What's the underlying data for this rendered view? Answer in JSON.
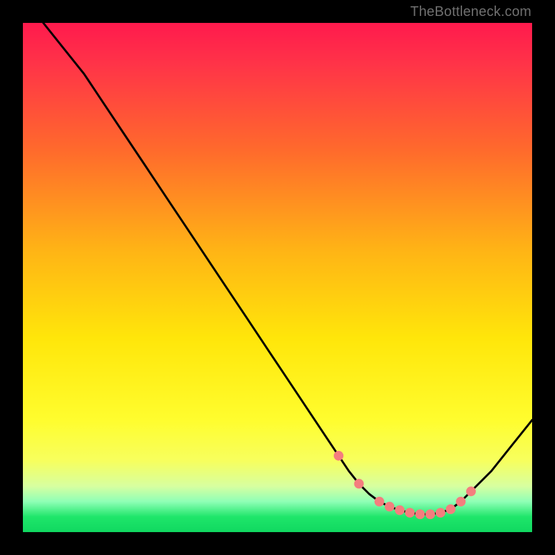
{
  "watermark": "TheBottleneck.com",
  "chart_data": {
    "type": "line",
    "title": "",
    "xlabel": "",
    "ylabel": "",
    "xlim": [
      0,
      100
    ],
    "ylim": [
      0,
      100
    ],
    "series": [
      {
        "name": "curve",
        "color": "#000000",
        "x": [
          4,
          8,
          12,
          16,
          20,
          24,
          28,
          32,
          36,
          40,
          44,
          48,
          52,
          56,
          60,
          62,
          64,
          66,
          68,
          70,
          72,
          74,
          76,
          78,
          80,
          82,
          84,
          86,
          88,
          92,
          96,
          100
        ],
        "y": [
          100,
          95,
          90,
          84,
          78,
          72,
          66,
          60,
          54,
          48,
          42,
          36,
          30,
          24,
          18,
          15,
          12,
          9.5,
          7.5,
          6,
          5,
          4.3,
          3.8,
          3.5,
          3.5,
          3.8,
          4.5,
          6,
          8,
          12,
          17,
          22
        ]
      }
    ],
    "highlight_points": {
      "color": "#f47e7e",
      "radius_px": 7,
      "x": [
        62,
        66,
        70,
        72,
        74,
        76,
        78,
        80,
        82,
        84,
        86,
        88
      ],
      "y": [
        15,
        9.5,
        6,
        5,
        4.3,
        3.8,
        3.5,
        3.5,
        3.8,
        4.5,
        6,
        8
      ]
    }
  }
}
